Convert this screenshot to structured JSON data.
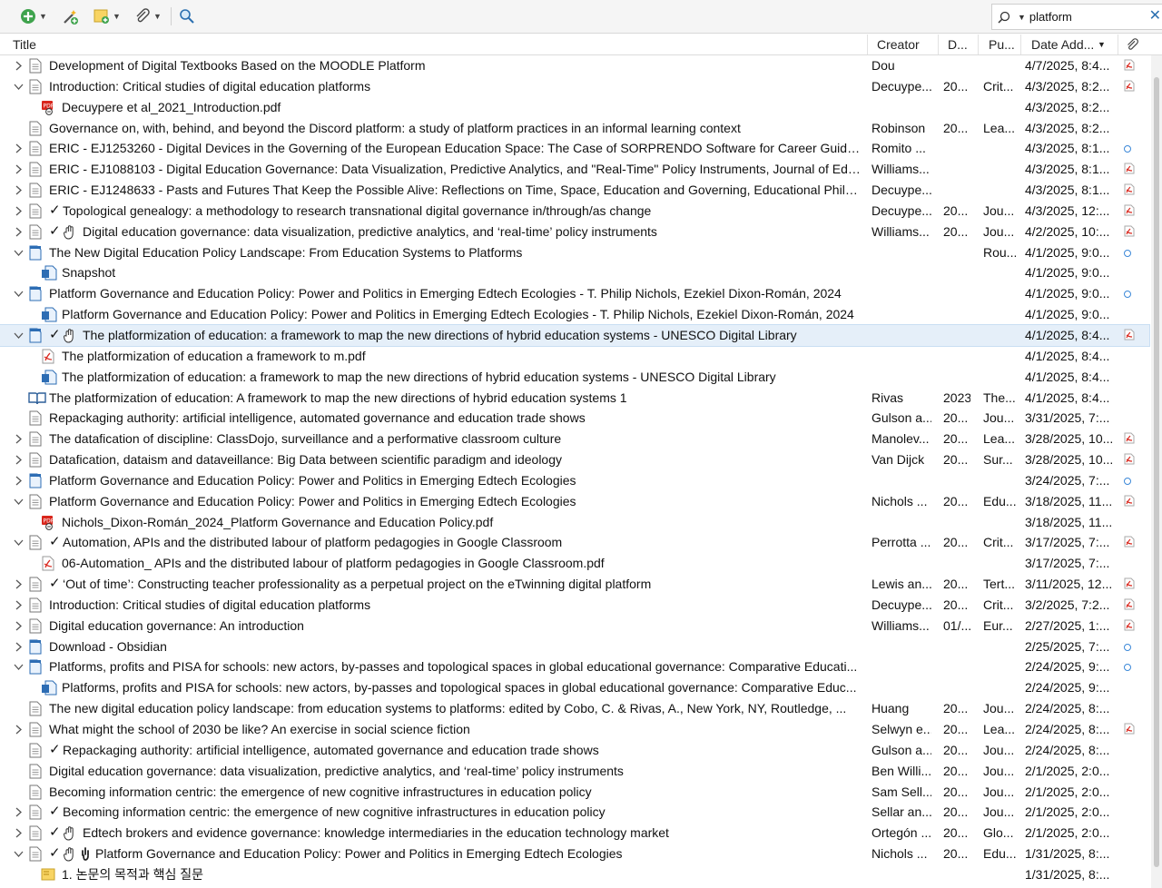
{
  "toolbar": {
    "buttons": [
      "new-item",
      "add-by-identifier",
      "new-note",
      "attach",
      "search"
    ],
    "search_value": "platform",
    "clear_glyph": "✕"
  },
  "columns": {
    "title": "Title",
    "creator": "Creator",
    "date": "D...",
    "publication": "Pu...",
    "date_added": "Date Add...",
    "sort_glyph": "▼"
  },
  "rows": [
    {
      "indent": 0,
      "twisty": "right",
      "icon": "doc",
      "check": false,
      "extra": "",
      "title": "Development of Digital Textbooks Based on the MOODLE Platform",
      "creator": "Dou",
      "date": "",
      "pub": "",
      "added": "4/7/2025, 8:4...",
      "att": "pdf"
    },
    {
      "indent": 0,
      "twisty": "down",
      "icon": "doc",
      "check": false,
      "extra": "",
      "title": "Introduction: Critical studies of digital education platforms",
      "creator": "Decuype...",
      "date": "20...",
      "pub": "Crit...",
      "added": "4/3/2025, 8:2...",
      "att": "pdf"
    },
    {
      "indent": 1,
      "twisty": "",
      "icon": "pdf-link",
      "check": false,
      "extra": "",
      "title": "Decuypere et al_2021_Introduction.pdf",
      "creator": "",
      "date": "",
      "pub": "",
      "added": "4/3/2025, 8:2...",
      "att": ""
    },
    {
      "indent": 0,
      "twisty": "",
      "icon": "doc",
      "check": false,
      "extra": "",
      "title": "Governance on, with, behind, and beyond the Discord platform: a study of platform practices in an informal learning context",
      "creator": "Robinson",
      "date": "20...",
      "pub": "Lea...",
      "added": "4/3/2025, 8:2...",
      "att": ""
    },
    {
      "indent": 0,
      "twisty": "right",
      "icon": "doc",
      "check": false,
      "extra": "",
      "title": "ERIC - EJ1253260 - Digital Devices in the Governing of the European Education Space: The Case of SORPRENDO Software for Career Guidan...",
      "creator": "Romito ...",
      "date": "",
      "pub": "",
      "added": "4/3/2025, 8:1...",
      "att": "dot"
    },
    {
      "indent": 0,
      "twisty": "right",
      "icon": "doc",
      "check": false,
      "extra": "",
      "title": "ERIC - EJ1088103 - Digital Education Governance: Data Visualization, Predictive Analytics, and \"Real-Time\" Policy Instruments, Journal of Edu...",
      "creator": "Williams...",
      "date": "",
      "pub": "",
      "added": "4/3/2025, 8:1...",
      "att": "pdf"
    },
    {
      "indent": 0,
      "twisty": "right",
      "icon": "doc",
      "check": false,
      "extra": "",
      "title": "ERIC - EJ1248633 - Pasts and Futures That Keep the Possible Alive: Reflections on Time, Space, Education and Governing, Educational Philos...",
      "creator": "Decuype...",
      "date": "",
      "pub": "",
      "added": "4/3/2025, 8:1...",
      "att": "pdf"
    },
    {
      "indent": 0,
      "twisty": "right",
      "icon": "doc",
      "check": true,
      "extra": "",
      "title": "Topological genealogy: a methodology to research transnational digital governance in/through/as change",
      "creator": "Decuype...",
      "date": "20...",
      "pub": "Jou...",
      "added": "4/3/2025, 12:...",
      "att": "pdf"
    },
    {
      "indent": 0,
      "twisty": "right",
      "icon": "doc",
      "check": true,
      "extra": "hand",
      "title": "Digital education governance: data visualization, predictive analytics, and ‘real-time’ policy instruments",
      "creator": "Williams...",
      "date": "20...",
      "pub": "Jou...",
      "added": "4/2/2025, 10:...",
      "att": "pdf"
    },
    {
      "indent": 0,
      "twisty": "down",
      "icon": "web",
      "check": false,
      "extra": "",
      "title": "The New Digital Education Policy Landscape: From Education Systems to Platforms",
      "creator": "",
      "date": "",
      "pub": "Rou...",
      "added": "4/1/2025, 9:0...",
      "att": "dot"
    },
    {
      "indent": 1,
      "twisty": "",
      "icon": "snapshot",
      "check": false,
      "extra": "",
      "title": "Snapshot",
      "creator": "",
      "date": "",
      "pub": "",
      "added": "4/1/2025, 9:0...",
      "att": ""
    },
    {
      "indent": 0,
      "twisty": "down",
      "icon": "web",
      "check": false,
      "extra": "",
      "title": "Platform Governance and Education Policy: Power and Politics in Emerging Edtech Ecologies - T. Philip Nichols, Ezekiel Dixon-Román, 2024",
      "creator": "",
      "date": "",
      "pub": "",
      "added": "4/1/2025, 9:0...",
      "att": "dot"
    },
    {
      "indent": 1,
      "twisty": "",
      "icon": "snapshot",
      "check": false,
      "extra": "",
      "title": "Platform Governance and Education Policy: Power and Politics in Emerging Edtech Ecologies - T. Philip Nichols, Ezekiel Dixon-Román, 2024",
      "creator": "",
      "date": "",
      "pub": "",
      "added": "4/1/2025, 9:0...",
      "att": ""
    },
    {
      "indent": 0,
      "twisty": "down",
      "icon": "web",
      "check": true,
      "extra": "hand",
      "selected": true,
      "title": "The platformization of education: a framework to map the new directions of hybrid education systems - UNESCO Digital Library",
      "creator": "",
      "date": "",
      "pub": "",
      "added": "4/1/2025, 8:4...",
      "att": "pdf"
    },
    {
      "indent": 1,
      "twisty": "",
      "icon": "pdf",
      "check": false,
      "extra": "",
      "title": "The platformization of education a framework to m.pdf",
      "creator": "",
      "date": "",
      "pub": "",
      "added": "4/1/2025, 8:4...",
      "att": ""
    },
    {
      "indent": 1,
      "twisty": "",
      "icon": "snapshot",
      "check": false,
      "extra": "",
      "title": "The platformization of education: a framework to map the new directions of hybrid education systems - UNESCO Digital Library",
      "creator": "",
      "date": "",
      "pub": "",
      "added": "4/1/2025, 8:4...",
      "att": ""
    },
    {
      "indent": 0,
      "twisty": "",
      "icon": "book",
      "check": false,
      "extra": "",
      "title": "The platformization of education: A framework to map the new directions of hybrid education systems 1",
      "creator": "Rivas",
      "date": "2023",
      "pub": "The...",
      "added": "4/1/2025, 8:4...",
      "att": ""
    },
    {
      "indent": 0,
      "twisty": "",
      "icon": "doc",
      "check": false,
      "extra": "",
      "title": "Repackaging authority: artificial intelligence, automated governance and education trade shows",
      "creator": "Gulson a...",
      "date": "20...",
      "pub": "Jou...",
      "added": "3/31/2025, 7:...",
      "att": ""
    },
    {
      "indent": 0,
      "twisty": "right",
      "icon": "doc",
      "check": false,
      "extra": "",
      "title": "The datafication of discipline: ClassDojo, surveillance and a performative classroom culture",
      "creator": "Manolev...",
      "date": "20...",
      "pub": "Lea...",
      "added": "3/28/2025, 10...",
      "att": "pdf"
    },
    {
      "indent": 0,
      "twisty": "right",
      "icon": "doc",
      "check": false,
      "extra": "",
      "title": "Datafication, dataism and dataveillance: Big Data between scientific paradigm and ideology",
      "creator": "Van Dijck",
      "date": "20...",
      "pub": "Sur...",
      "added": "3/28/2025, 10...",
      "att": "pdf"
    },
    {
      "indent": 0,
      "twisty": "right",
      "icon": "web",
      "check": false,
      "extra": "",
      "title": "Platform Governance and Education Policy: Power and Politics in Emerging Edtech Ecologies",
      "creator": "",
      "date": "",
      "pub": "",
      "added": "3/24/2025, 7:...",
      "att": "dot"
    },
    {
      "indent": 0,
      "twisty": "down",
      "icon": "doc",
      "check": false,
      "extra": "",
      "title": "Platform Governance and Education Policy: Power and Politics in Emerging Edtech Ecologies",
      "creator": "Nichols ...",
      "date": "20...",
      "pub": "Edu...",
      "added": "3/18/2025, 11...",
      "att": "pdf"
    },
    {
      "indent": 1,
      "twisty": "",
      "icon": "pdf-link",
      "check": false,
      "extra": "",
      "title": "Nichols_Dixon-Román_2024_Platform Governance and Education Policy.pdf",
      "creator": "",
      "date": "",
      "pub": "",
      "added": "3/18/2025, 11...",
      "att": ""
    },
    {
      "indent": 0,
      "twisty": "down",
      "icon": "doc",
      "check": true,
      "extra": "",
      "title": "Automation, APIs and the distributed labour of platform pedagogies in Google Classroom",
      "creator": "Perrotta ...",
      "date": "20...",
      "pub": "Crit...",
      "added": "3/17/2025, 7:...",
      "att": "pdf"
    },
    {
      "indent": 1,
      "twisty": "",
      "icon": "pdf",
      "check": false,
      "extra": "",
      "title": "06-Automation_ APIs and the distributed labour of platform pedagogies in Google Classroom.pdf",
      "creator": "",
      "date": "",
      "pub": "",
      "added": "3/17/2025, 7:...",
      "att": ""
    },
    {
      "indent": 0,
      "twisty": "right",
      "icon": "doc",
      "check": true,
      "extra": "",
      "title": "‘Out of time’: Constructing teacher professionality as a perpetual project on the eTwinning digital platform",
      "creator": "Lewis an...",
      "date": "20...",
      "pub": "Tert...",
      "added": "3/11/2025, 12...",
      "att": "pdf"
    },
    {
      "indent": 0,
      "twisty": "right",
      "icon": "doc",
      "check": false,
      "extra": "",
      "title": "Introduction: Critical studies of digital education platforms",
      "creator": "Decuype...",
      "date": "20...",
      "pub": "Crit...",
      "added": "3/2/2025, 7:2...",
      "att": "pdf"
    },
    {
      "indent": 0,
      "twisty": "right",
      "icon": "doc",
      "check": false,
      "extra": "",
      "title": "Digital education governance: An introduction",
      "creator": "Williams...",
      "date": "01/...",
      "pub": "Eur...",
      "added": "2/27/2025, 1:...",
      "att": "pdf"
    },
    {
      "indent": 0,
      "twisty": "right",
      "icon": "web",
      "check": false,
      "extra": "",
      "title": "Download - Obsidian",
      "creator": "",
      "date": "",
      "pub": "",
      "added": "2/25/2025, 7:...",
      "att": "dot"
    },
    {
      "indent": 0,
      "twisty": "down",
      "icon": "web",
      "check": false,
      "extra": "",
      "title": "Platforms, profits and PISA for schools: new actors, by-passes and topological spaces in global educational governance: Comparative Educati...",
      "creator": "",
      "date": "",
      "pub": "",
      "added": "2/24/2025, 9:...",
      "att": "dot"
    },
    {
      "indent": 1,
      "twisty": "",
      "icon": "snapshot",
      "check": false,
      "extra": "",
      "title": "Platforms, profits and PISA for schools: new actors, by-passes and topological spaces in global educational governance: Comparative Educ...",
      "creator": "",
      "date": "",
      "pub": "",
      "added": "2/24/2025, 9:...",
      "att": ""
    },
    {
      "indent": 0,
      "twisty": "",
      "icon": "doc",
      "check": false,
      "extra": "",
      "title": "The new digital education policy landscape: from education systems to platforms: edited by Cobo, C. & Rivas, A., New York, NY, Routledge, ...",
      "creator": "Huang",
      "date": "20...",
      "pub": "Jou...",
      "added": "2/24/2025, 8:...",
      "att": ""
    },
    {
      "indent": 0,
      "twisty": "right",
      "icon": "doc",
      "check": false,
      "extra": "",
      "title": "What might the school of 2030 be like? An exercise in social science fiction",
      "creator": "Selwyn e...",
      "date": "20...",
      "pub": "Lea...",
      "added": "2/24/2025, 8:...",
      "att": "pdf"
    },
    {
      "indent": 0,
      "twisty": "",
      "icon": "doc",
      "check": true,
      "extra": "",
      "title": "Repackaging authority: artificial intelligence, automated governance and education trade shows",
      "creator": "Gulson a...",
      "date": "20...",
      "pub": "Jou...",
      "added": "2/24/2025, 8:...",
      "att": ""
    },
    {
      "indent": 0,
      "twisty": "",
      "icon": "doc",
      "check": false,
      "extra": "",
      "title": "Digital education governance: data visualization, predictive analytics, and ‘real-time’ policy instruments",
      "creator": "Ben Willi...",
      "date": "20...",
      "pub": "Jou...",
      "added": "2/1/2025, 2:0...",
      "att": ""
    },
    {
      "indent": 0,
      "twisty": "",
      "icon": "doc",
      "check": false,
      "extra": "",
      "title": "Becoming information centric: the emergence of new cognitive infrastructures in education policy",
      "creator": "Sam Sell...",
      "date": "20...",
      "pub": "Jou...",
      "added": "2/1/2025, 2:0...",
      "att": ""
    },
    {
      "indent": 0,
      "twisty": "right",
      "icon": "doc",
      "check": true,
      "extra": "",
      "title": "Becoming information centric: the emergence of new cognitive infrastructures in education policy",
      "creator": "Sellar an...",
      "date": "20...",
      "pub": "Jou...",
      "added": "2/1/2025, 2:0...",
      "att": ""
    },
    {
      "indent": 0,
      "twisty": "right",
      "icon": "doc",
      "check": true,
      "extra": "hand",
      "title": "Edtech brokers and evidence governance: knowledge intermediaries in the education technology market",
      "creator": "Ortegón ...",
      "date": "20...",
      "pub": "Glo...",
      "added": "2/1/2025, 2:0...",
      "att": ""
    },
    {
      "indent": 0,
      "twisty": "down",
      "icon": "doc",
      "check": true,
      "extra": "hand2",
      "title": "Platform Governance and Education Policy: Power and Politics in Emerging Edtech Ecologies",
      "creator": "Nichols ...",
      "date": "20...",
      "pub": "Edu...",
      "added": "1/31/2025, 8:...",
      "att": ""
    },
    {
      "indent": 1,
      "twisty": "",
      "icon": "note",
      "check": false,
      "extra": "",
      "title": "1. 논문의 목적과 핵심 질문",
      "creator": "",
      "date": "",
      "pub": "",
      "added": "1/31/2025, 8:...",
      "att": ""
    }
  ]
}
